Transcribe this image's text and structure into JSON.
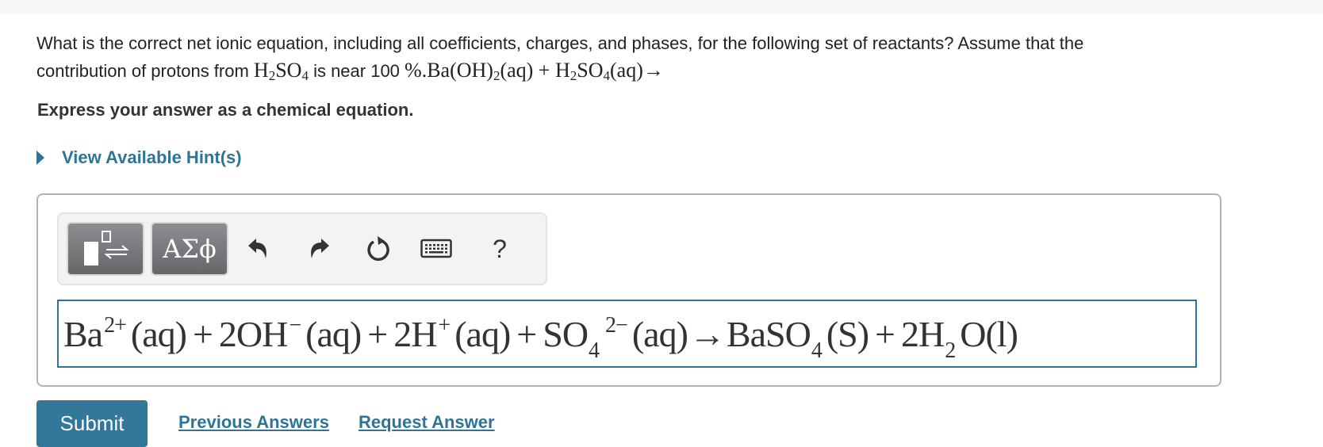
{
  "question": {
    "line1": "What is the correct net ionic equation, including all coefficients, charges, and phases, for the following set of reactants? Assume that the",
    "line2_prefix": "contribution of protons from ",
    "acid_formula": {
      "H": "H",
      "h_sub": "2",
      "SO": "SO",
      "o_sub": "4"
    },
    "line2_middle": " is near 100 ",
    "percent_reaction": "%.Ba(OH)",
    "oh_sub": "2",
    "reaction_rest": "(aq) + H",
    "h_sub2": "2",
    "so": "SO",
    "o_sub2": "4",
    "reaction_end": "(aq)→"
  },
  "instruction": "Express your answer as a chemical equation.",
  "hint": {
    "label": "View Available Hint(s)",
    "icon": "triangle-right-icon"
  },
  "toolbar": {
    "templates_icon": "templates-icon",
    "greek_label": "ΑΣϕ",
    "undo_icon": "undo-icon",
    "redo_icon": "redo-icon",
    "reset_icon": "reset-icon",
    "keyboard_icon": "keyboard-icon",
    "help_label": "?"
  },
  "answer": {
    "terms": [
      {
        "base": "Ba",
        "sup": "2+",
        "phase": "(aq)"
      },
      {
        "op": "+"
      },
      {
        "base": "2OH",
        "sup": "−",
        "phase": "(aq)"
      },
      {
        "op": "+"
      },
      {
        "base": "2H",
        "sup": "+",
        "phase": "(aq)"
      },
      {
        "op": "+"
      },
      {
        "base": "SO",
        "sub": "4",
        "sup": "2−",
        "phase": "(aq)"
      },
      {
        "op": "→"
      },
      {
        "base": "BaSO",
        "sub": "4",
        "phase": "(S)"
      },
      {
        "op": "+"
      },
      {
        "base": "2H",
        "sub": "2",
        "tail": "O",
        "phase": "(l)"
      }
    ]
  },
  "actions": {
    "submit_label": "Submit",
    "previous_answers_label": "Previous Answers",
    "request_answer_label": "Request Answer"
  },
  "colors": {
    "accent": "#2f7496",
    "submit_bg": "#337799",
    "text": "#222222"
  }
}
